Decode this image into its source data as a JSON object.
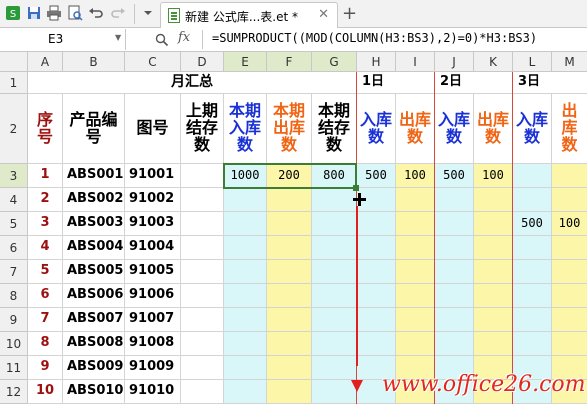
{
  "toolbar": {
    "tab_title": "新建 公式库...表.et *",
    "close_glyph": "✕",
    "new_tab_glyph": "+",
    "icons": [
      "app-logo-icon",
      "save-icon",
      "print-icon",
      "print-preview-icon",
      "undo-icon",
      "redo-icon",
      "more-icon"
    ]
  },
  "formula_bar": {
    "cell_ref": "E3",
    "fx": "fx",
    "formula": "=SUMPRODUCT((MOD(COLUMN(H3:BS3),2)=0)*H3:BS3)"
  },
  "columns": [
    "A",
    "B",
    "C",
    "D",
    "E",
    "F",
    "G",
    "H",
    "I",
    "J",
    "K",
    "L",
    "M"
  ],
  "rows": [
    "1",
    "2",
    "3",
    "4",
    "5",
    "6",
    "7",
    "8",
    "9",
    "10",
    "11",
    "12"
  ],
  "header_row1": {
    "month_summary": "月汇总",
    "day1": "1日",
    "day2": "2日",
    "day3": "3日"
  },
  "header_row2": {
    "seq": "序号",
    "product_code": "产品编号",
    "drawing_no": "图号",
    "prev_stock": "上期结存数",
    "cur_in": "本期入库数",
    "cur_out": "本期出库数",
    "cur_stock": "本期结存数",
    "in": "入库数",
    "out": "出库数"
  },
  "rows_data": [
    {
      "seq": "1",
      "code": "ABS001",
      "drawing": "91001",
      "E": "1000",
      "F": "200",
      "G": "800",
      "H": "500",
      "I": "100",
      "J": "500",
      "K": "100",
      "L": "",
      "M": ""
    },
    {
      "seq": "2",
      "code": "ABS002",
      "drawing": "91002",
      "E": "",
      "F": "",
      "G": "",
      "H": "",
      "I": "",
      "J": "",
      "K": "",
      "L": "",
      "M": ""
    },
    {
      "seq": "3",
      "code": "ABS003",
      "drawing": "91003",
      "E": "",
      "F": "",
      "G": "",
      "H": "",
      "I": "",
      "J": "",
      "K": "",
      "L": "500",
      "M": "100"
    },
    {
      "seq": "4",
      "code": "ABS004",
      "drawing": "91004",
      "E": "",
      "F": "",
      "G": "",
      "H": "",
      "I": "",
      "J": "",
      "K": "",
      "L": "",
      "M": ""
    },
    {
      "seq": "5",
      "code": "ABS005",
      "drawing": "91005",
      "E": "",
      "F": "",
      "G": "",
      "H": "",
      "I": "",
      "J": "",
      "K": "",
      "L": "",
      "M": ""
    },
    {
      "seq": "6",
      "code": "ABS006",
      "drawing": "91006",
      "E": "",
      "F": "",
      "G": "",
      "H": "",
      "I": "",
      "J": "",
      "K": "",
      "L": "",
      "M": ""
    },
    {
      "seq": "7",
      "code": "ABS007",
      "drawing": "91007",
      "E": "",
      "F": "",
      "G": "",
      "H": "",
      "I": "",
      "J": "",
      "K": "",
      "L": "",
      "M": ""
    },
    {
      "seq": "8",
      "code": "ABS008",
      "drawing": "91008",
      "E": "",
      "F": "",
      "G": "",
      "H": "",
      "I": "",
      "J": "",
      "K": "",
      "L": "",
      "M": ""
    },
    {
      "seq": "9",
      "code": "ABS009",
      "drawing": "91009",
      "E": "",
      "F": "",
      "G": "",
      "H": "",
      "I": "",
      "J": "",
      "K": "",
      "L": "",
      "M": ""
    },
    {
      "seq": "10",
      "code": "ABS010",
      "drawing": "91010",
      "E": "",
      "F": "",
      "G": "",
      "H": "",
      "I": "",
      "J": "",
      "K": "",
      "L": "",
      "M": ""
    }
  ],
  "watermark": "www.office26.com",
  "colors": {
    "in_blue": "#1a31d6",
    "out_orange": "#f06414",
    "seq_red": "#9c1010",
    "cyan_fill": "#d9f7f9",
    "yellow_fill": "#fbf6a8",
    "selection_green": "#3c7d36",
    "arrow_red": "#e02020"
  }
}
